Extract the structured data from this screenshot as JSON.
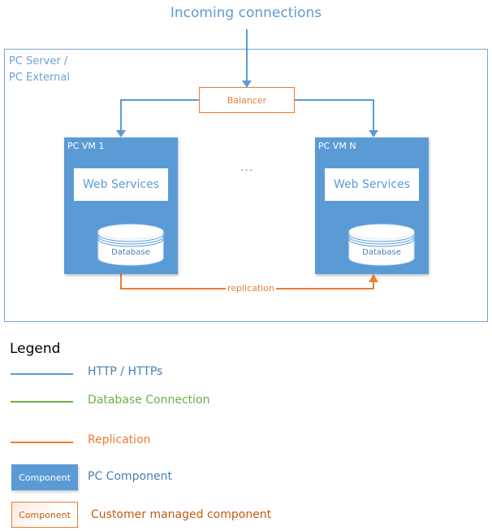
{
  "diagram": {
    "title": "Incoming connections",
    "container": {
      "label_line1": "PC Server /",
      "label_line2": "PC External"
    },
    "balancer": {
      "label": "Balancer"
    },
    "vms": [
      {
        "label": "PC VM 1",
        "web_services": "Web Services",
        "database": "Database"
      },
      {
        "label": "PC VM N",
        "web_services": "Web Services",
        "database": "Database"
      }
    ],
    "ellipsis": "...",
    "replication_label": "replication"
  },
  "legend": {
    "title": "Legend",
    "lines": [
      {
        "label": "HTTP / HTTPs",
        "color": "#5b9bd5"
      },
      {
        "label": "Database Connection",
        "color": "#70ad47"
      },
      {
        "label": "Replication",
        "color": "#ed7d31"
      }
    ],
    "components": [
      {
        "box_label": "Component",
        "label": "PC Component",
        "color": "#5b9bd5"
      },
      {
        "box_label": "Component",
        "label": "Customer managed component",
        "color": "#c55a11"
      }
    ]
  }
}
